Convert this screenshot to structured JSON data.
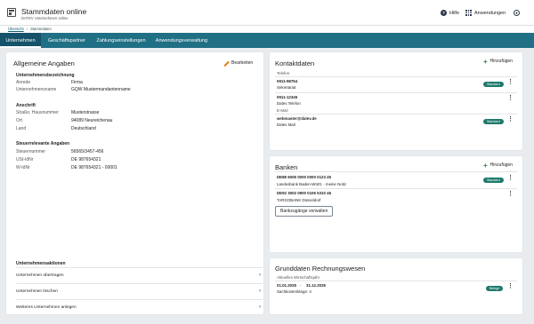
{
  "header": {
    "title": "Stammdaten online",
    "subtitle": "DATEV Unternehmen online",
    "help_label": "Hilfe",
    "apps_label": "Anwendungen"
  },
  "breadcrumb": {
    "items": [
      "Übersicht",
      "Stammdaten"
    ]
  },
  "tabs": [
    {
      "label": "Unternehmen",
      "active": true
    },
    {
      "label": "Geschäftspartner",
      "active": false
    },
    {
      "label": "Zahlungseinstellungen",
      "active": false
    },
    {
      "label": "Anwendungsverwaltung",
      "active": false
    }
  ],
  "general": {
    "title": "Allgemeine Angaben",
    "edit_label": "Bearbeiten",
    "company_section": "Unternehmensbezeichnung",
    "salutation_label": "Anrede",
    "salutation_value": "Firma",
    "company_name_label": "Unternehmensname",
    "company_name_value": "GQW Mustermandantenname",
    "address_section": "Anschrift",
    "street_label": "Straße, Hausnummer",
    "street_value": "Musterstrasse",
    "city_label": "Ort",
    "city_value": "94089 Neureichenau",
    "country_label": "Land",
    "country_value": "Deutschland",
    "tax_section": "Steuerrelevante Angaben",
    "taxno_label": "Steuernummer",
    "taxno_value": "56565/3457-456",
    "vatid_label": "USt-IdNr",
    "vatid_value": "DE 987654321",
    "wid_label": "W-IdNr",
    "wid_value": "DE 987654321 - 00001"
  },
  "actions": {
    "title": "Unternehmensaktionen",
    "items": [
      "Unternehmen übertragen",
      "Unternehmen löschen",
      "Weiteres Unternehmen anlegen"
    ]
  },
  "contact": {
    "title": "Kontaktdaten",
    "add_label": "Hinzufügen",
    "phone_label": "Telefon",
    "phone1_value": "0911-98754",
    "phone1_desc": "Sekretariat",
    "phone1_badge": "Standard",
    "phone2_value": "0911-12345",
    "phone2_desc": "Datev Telefon",
    "email_label": "E-Mail",
    "email_value": "webmaster@datev.de",
    "email_desc": "Datev Mail",
    "email_badge": "Standard"
  },
  "banks": {
    "title": "Banken",
    "add_label": "Hinzufügen",
    "bank1_iban": "DE88 6005 0000 0000 0123 45",
    "bank1_desc": "Landesbank Baden-Württ. - meine Notiz",
    "bank1_badge": "Standard",
    "bank2_iban": "DE92 3002 0900 0106 5310 46",
    "bank2_desc": "TARGOBANK Düsseldorf",
    "manage_label": "Bankzugänge verwalten"
  },
  "accounting": {
    "title": "Grunddaten Rechnungswesen",
    "fy_label": "Aktuelles Wirtschaftsjahr",
    "fy_start": "01.01.2025",
    "fy_sep": "-",
    "fy_end": "31.12.2025",
    "account_length": "Sachkontenlänge: 4",
    "badge": "Belege"
  },
  "colors": {
    "tabbar": "#1f6f85",
    "badge": "#1f7a6b",
    "add_icon": "#2e8b3a",
    "edit_icon": "#e07d10"
  }
}
